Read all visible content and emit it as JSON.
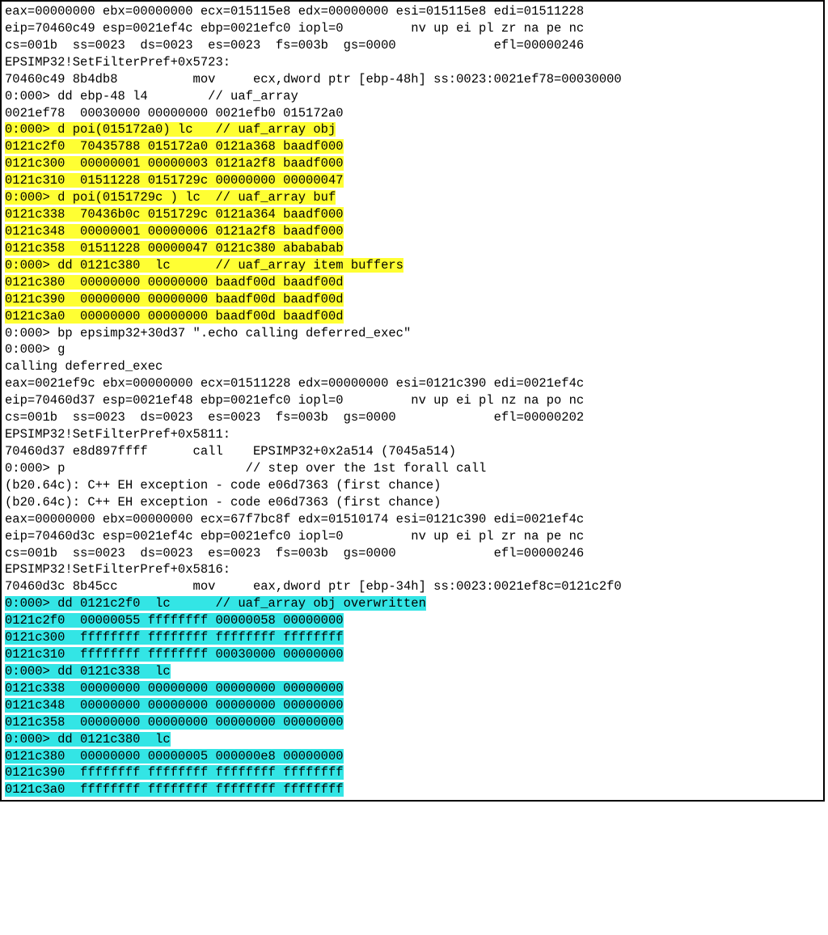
{
  "lines": [
    {
      "h": null,
      "t": "eax=00000000 ebx=00000000 ecx=015115e8 edx=00000000 esi=015115e8 edi=01511228"
    },
    {
      "h": null,
      "t": "eip=70460c49 esp=0021ef4c ebp=0021efc0 iopl=0         nv up ei pl zr na pe nc"
    },
    {
      "h": null,
      "t": "cs=001b  ss=0023  ds=0023  es=0023  fs=003b  gs=0000             efl=00000246"
    },
    {
      "h": null,
      "t": "EPSIMP32!SetFilterPref+0x5723:"
    },
    {
      "h": null,
      "t": "70460c49 8b4db8          mov     ecx,dword ptr [ebp-48h] ss:0023:0021ef78=00030000"
    },
    {
      "h": null,
      "t": "0:000> dd ebp-48 l4        // uaf_array"
    },
    {
      "h": null,
      "t": "0021ef78  00030000 00000000 0021efb0 015172a0"
    },
    {
      "h": "y",
      "t": "0:000> d poi(015172a0) lc   // uaf_array obj"
    },
    {
      "h": "y",
      "t": "0121c2f0  70435788 015172a0 0121a368 baadf000"
    },
    {
      "h": "y",
      "t": "0121c300  00000001 00000003 0121a2f8 baadf000"
    },
    {
      "h": "y",
      "t": "0121c310  01511228 0151729c 00000000 00000047"
    },
    {
      "h": "y",
      "t": "0:000> d poi(0151729c ) lc  // uaf_array buf"
    },
    {
      "h": "y",
      "t": "0121c338  70436b0c 0151729c 0121a364 baadf000"
    },
    {
      "h": "y",
      "t": "0121c348  00000001 00000006 0121a2f8 baadf000"
    },
    {
      "h": "y",
      "t": "0121c358  01511228 00000047 0121c380 abababab"
    },
    {
      "h": "y",
      "t": "0:000> dd 0121c380  lc      // uaf_array item buffers"
    },
    {
      "h": "y",
      "t": "0121c380  00000000 00000000 baadf00d baadf00d"
    },
    {
      "h": "y",
      "t": "0121c390  00000000 00000000 baadf00d baadf00d"
    },
    {
      "h": "y",
      "t": "0121c3a0  00000000 00000000 baadf00d baadf00d"
    },
    {
      "h": null,
      "t": "0:000> bp epsimp32+30d37 \".echo calling deferred_exec\""
    },
    {
      "h": null,
      "t": "0:000> g"
    },
    {
      "h": null,
      "t": "calling deferred_exec"
    },
    {
      "h": null,
      "t": "eax=0021ef9c ebx=00000000 ecx=01511228 edx=00000000 esi=0121c390 edi=0021ef4c"
    },
    {
      "h": null,
      "t": "eip=70460d37 esp=0021ef48 ebp=0021efc0 iopl=0         nv up ei pl nz na po nc"
    },
    {
      "h": null,
      "t": "cs=001b  ss=0023  ds=0023  es=0023  fs=003b  gs=0000             efl=00000202"
    },
    {
      "h": null,
      "t": "EPSIMP32!SetFilterPref+0x5811:"
    },
    {
      "h": null,
      "t": "70460d37 e8d897ffff      call    EPSIMP32+0x2a514 (7045a514)"
    },
    {
      "h": null,
      "t": "0:000> p                        // step over the 1st forall call"
    },
    {
      "h": null,
      "t": "(b20.64c): C++ EH exception - code e06d7363 (first chance)"
    },
    {
      "h": null,
      "t": "(b20.64c): C++ EH exception - code e06d7363 (first chance)"
    },
    {
      "h": null,
      "t": "eax=00000000 ebx=00000000 ecx=67f7bc8f edx=01510174 esi=0121c390 edi=0021ef4c"
    },
    {
      "h": null,
      "t": "eip=70460d3c esp=0021ef4c ebp=0021efc0 iopl=0         nv up ei pl zr na pe nc"
    },
    {
      "h": null,
      "t": "cs=001b  ss=0023  ds=0023  es=0023  fs=003b  gs=0000             efl=00000246"
    },
    {
      "h": null,
      "t": "EPSIMP32!SetFilterPref+0x5816:"
    },
    {
      "h": null,
      "t": "70460d3c 8b45cc          mov     eax,dword ptr [ebp-34h] ss:0023:0021ef8c=0121c2f0"
    },
    {
      "h": "c",
      "t": "0:000> dd 0121c2f0  lc      // uaf_array obj overwritten"
    },
    {
      "h": "c",
      "t": "0121c2f0  00000055 ffffffff 00000058 00000000"
    },
    {
      "h": "c",
      "t": "0121c300  ffffffff ffffffff ffffffff ffffffff"
    },
    {
      "h": "c",
      "t": "0121c310  ffffffff ffffffff 00030000 00000000"
    },
    {
      "h": "c",
      "t": "0:000> dd 0121c338  lc"
    },
    {
      "h": "c",
      "t": "0121c338  00000000 00000000 00000000 00000000"
    },
    {
      "h": "c",
      "t": "0121c348  00000000 00000000 00000000 00000000"
    },
    {
      "h": "c",
      "t": "0121c358  00000000 00000000 00000000 00000000"
    },
    {
      "h": "c",
      "t": "0:000> dd 0121c380  lc"
    },
    {
      "h": "c",
      "t": "0121c380  00000000 00000005 000000e8 00000000"
    },
    {
      "h": "c",
      "t": "0121c390  ffffffff ffffffff ffffffff ffffffff"
    },
    {
      "h": "c",
      "t": "0121c3a0  ffffffff ffffffff ffffffff ffffffff"
    }
  ]
}
